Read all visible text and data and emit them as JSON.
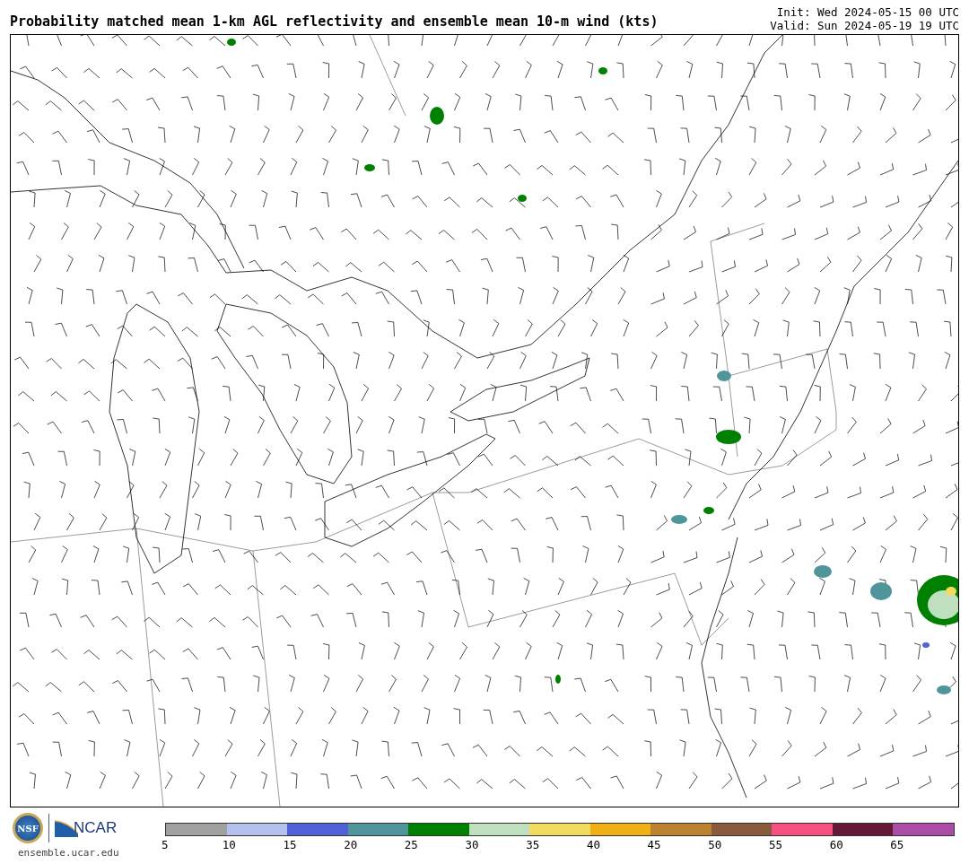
{
  "title": "Probability matched mean 1-km AGL reflectivity and ensemble mean 10-m wind (kts)",
  "init": "Init: Wed 2024-05-15 00 UTC",
  "valid": "Valid: Sun 2024-05-19 19 UTC",
  "logo": {
    "nsf": "NSF",
    "ncar": "NCAR"
  },
  "site": "ensemble.ucar.edu",
  "colorbar": {
    "bins": [
      {
        "color": "#a0a0a0"
      },
      {
        "color": "#b4c0ee"
      },
      {
        "color": "#5060d6"
      },
      {
        "color": "#4f969c"
      },
      {
        "color": "#008000"
      },
      {
        "color": "#bfe0bf"
      },
      {
        "color": "#f2dc60"
      },
      {
        "color": "#f0b014"
      },
      {
        "color": "#bd8230"
      },
      {
        "color": "#8a5a3c"
      },
      {
        "color": "#f55080"
      },
      {
        "color": "#641736"
      },
      {
        "color": "#ad4ca6"
      }
    ],
    "ticks": [
      "5",
      "10",
      "15",
      "20",
      "25",
      "30",
      "35",
      "40",
      "45",
      "50",
      "55",
      "60",
      "65"
    ]
  }
}
